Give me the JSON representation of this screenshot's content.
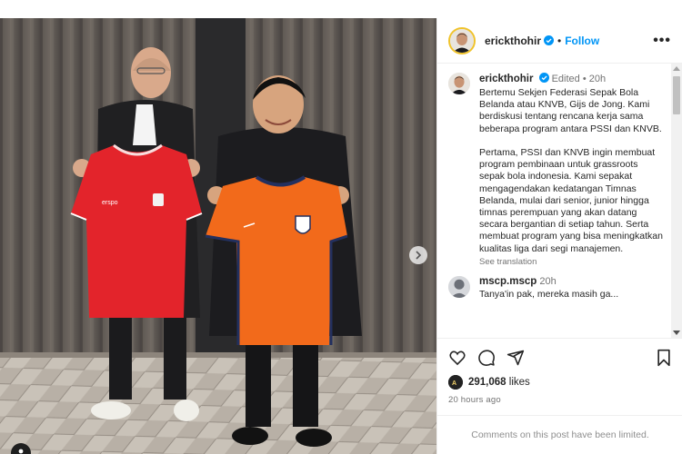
{
  "post": {
    "username": "erickthohir",
    "follow_label": "Follow",
    "more_label": "•••",
    "separator": "•"
  },
  "caption": {
    "username": "erickthohir",
    "edited": "Edited",
    "age": "20h",
    "text": "Bertemu Sekjen Federasi Sepak Bola Belanda atau KNVB, Gijs de Jong. Kami berdiskusi tentang rencana kerja sama beberapa program antara PSSI dan KNVB.\n\nPertama, PSSI dan KNVB ingin membuat program pembinaan untuk grassroots sepak bola indonesia. Kami sepakat mengagendakan kedatangan Timnas Belanda, mulai dari senior, junior hingga timnas perempuan yang akan datang secara bergantian di setiap tahun. Serta membuat program yang bisa meningkatkan kualitas liga dari segi manajemen.",
    "see_translation": "See translation"
  },
  "comment": {
    "username": "mscp.mscp",
    "age": "20h",
    "partial_text": "Tanya'in pak, mereka masih ga..."
  },
  "engagement": {
    "likes_count": "291,068",
    "likes_word": "likes",
    "posted": "20 hours ago",
    "comments_limited": "Comments on this post have been limited."
  },
  "photo": {
    "jersey_left_brand": "erspo"
  },
  "colors": {
    "accent": "#0095f6",
    "verified": "#0095f6",
    "jersey_red": "#e3242b",
    "jersey_orange": "#f26a1b"
  },
  "icons": [
    "verified-icon",
    "more-icon",
    "heart-icon",
    "comment-icon",
    "share-icon",
    "bookmark-icon",
    "next-arrow-icon",
    "user-tag-icon"
  ]
}
